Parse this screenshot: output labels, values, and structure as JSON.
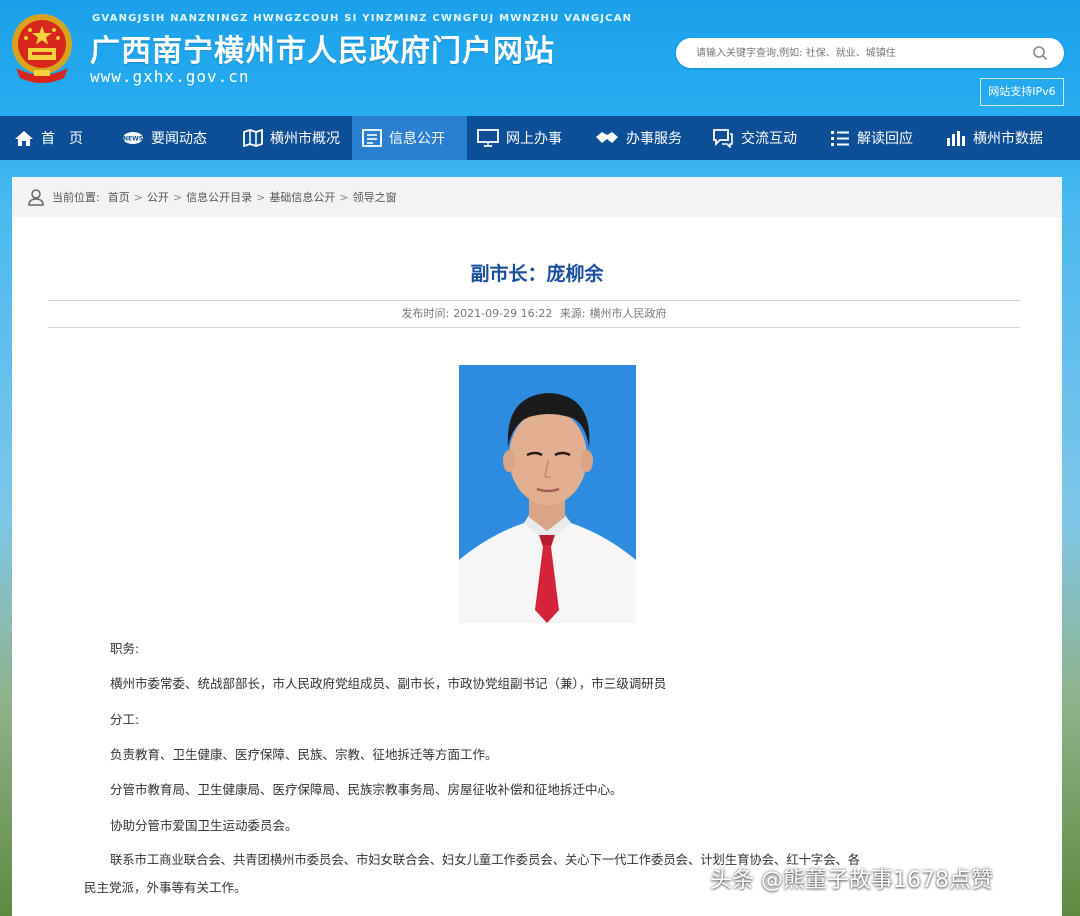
{
  "header": {
    "pinyin": "GVANGJSIH NANZNINGZ HWNGZCOUH SI YINZMINZ CWNGFUJ MWNZHU VANGJCAN",
    "site_title": "广西南宁横州市人民政府门户网站",
    "site_url": "www.gxhx.gov.cn",
    "search_placeholder": "请输入关键字查询,例如: 社保、就业、城镇住",
    "ipv6_label": "网站支持IPv6"
  },
  "nav": {
    "items": [
      {
        "label": "首　页",
        "icon": "home-icon"
      },
      {
        "label": "要闻动态",
        "icon": "news-icon"
      },
      {
        "label": "横州市概况",
        "icon": "map-icon"
      },
      {
        "label": "信息公开",
        "icon": "document-icon",
        "active": true
      },
      {
        "label": "网上办事",
        "icon": "monitor-icon"
      },
      {
        "label": "办事服务",
        "icon": "handshake-icon"
      },
      {
        "label": "交流互动",
        "icon": "chat-icon"
      },
      {
        "label": "解读回应",
        "icon": "list-icon"
      },
      {
        "label": "横州市数据",
        "icon": "bar-chart-icon"
      }
    ]
  },
  "breadcrumb": {
    "prefix": "当前位置:",
    "items": [
      "首页",
      "公开",
      "信息公开目录",
      "基础信息公开",
      "领导之窗"
    ]
  },
  "article": {
    "title": "副市长：庞柳余",
    "publish_label": "发布时间:",
    "publish_time": "2021-09-29 16:22",
    "source_label": "来源:",
    "source": "横州市人民政府",
    "paragraphs": [
      "职务:",
      "横州市委常委、统战部部长，市人民政府党组成员、副市长，市政协党组副书记（兼），市三级调研员",
      "分工:",
      "负责教育、卫生健康、医疗保障、民族、宗教、征地拆迁等方面工作。",
      "分管市教育局、卫生健康局、医疗保障局、民族宗教事务局、房屋征收补偿和征地拆迁中心。",
      "协助分管市爱国卫生运动委员会。",
      "联系市工商业联合会、共青团横州市委员会、市妇女联合会、妇女儿童工作委员会、关心下一代工作委员会、计划生育协会、红十字会、各",
      "民主党派，外事等有关工作。"
    ]
  },
  "watermark": "头条 @熊董子故事1678点赞",
  "colors": {
    "nav_bg": "#0c4f96",
    "nav_active": "#2a7fd0",
    "title_blue": "#1a4fa0",
    "header_blue": "#1aa0ea"
  }
}
